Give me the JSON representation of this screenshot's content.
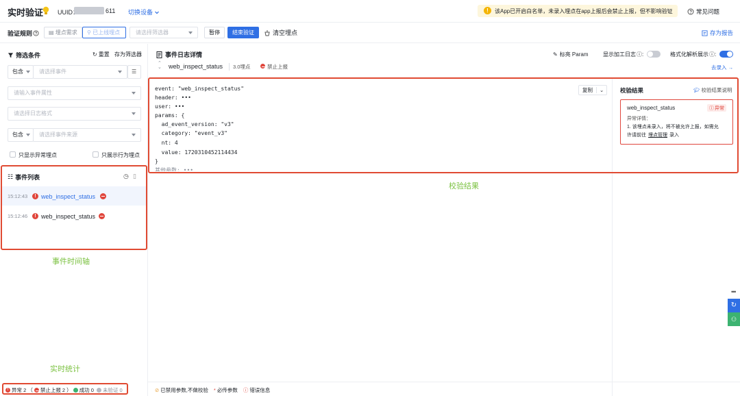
{
  "header": {
    "title": "实时验证",
    "uuid_label": "UUID：",
    "uuid_value": "611",
    "switch_device": "切换设备",
    "notice": "该App已开启白名单，未录入埋点在app上报后会禁止上报，但不影响验证",
    "faq": "常见问题"
  },
  "rulebar": {
    "label": "验证规则",
    "tracking_need": "埋点需求",
    "online_tracking": "已上线埋点",
    "filter_placeholder": "请选择筛选器",
    "pause": "暂停",
    "end_verify": "结束验证",
    "clear": "清空埋点",
    "save_report": "存为报告"
  },
  "filter": {
    "title": "筛选条件",
    "reset": "重置",
    "save_filter": "存为筛选器",
    "include_1": "包含",
    "event_placeholder": "请选择事件",
    "attr_placeholder": "请输入事件属性",
    "log_format_placeholder": "请选择日志格式",
    "include_2": "包含",
    "source_placeholder": "请选择事件来源",
    "only_abnormal": "只显示异常埋点",
    "only_behavior": "只展示行为埋点"
  },
  "event_list": {
    "title": "事件列表",
    "items": [
      {
        "time": "15:12:43",
        "name": "web_inspect_status"
      },
      {
        "time": "15:12:46",
        "name": "web_inspect_status"
      }
    ]
  },
  "detail": {
    "title": "事件日志详情",
    "highlight_param": "标亮 Param",
    "show_processed_log": "显示加工日志",
    "formatted_display": "格式化解析展示",
    "event_name": "web_inspect_status",
    "version": "3.0埋点",
    "forbid": "禁止上报",
    "go_record": "去录入 →",
    "copy": "复制"
  },
  "code_lines": [
    "event: \"web_inspect_status\"",
    "header: •••",
    "user: •••",
    "params: {",
    "  ad_event_version: \"v3\"",
    "  category: \"event_v3\"",
    "  nt: 4",
    "  value: 1720310452114434",
    "}",
    "其他参数: •••"
  ],
  "result": {
    "title": "校验结果",
    "explain": "校验结果说明",
    "event_name": "web_inspect_status",
    "badge": "异常",
    "detail_label": "异常详情：",
    "detail_text_1": "1. 该埋点未录入，将不被允许上报，如需允",
    "detail_text_2_prefix": "许请前往",
    "detail_link": "埋点管理",
    "detail_text_2_suffix": "录入"
  },
  "annotations": {
    "verify_result": "校验结果",
    "event_timeline": "事件时间轴",
    "realtime_stats": "实时统计"
  },
  "footer": {
    "abnormal": "异常 2 （",
    "forbid": "禁止上报 2 ）",
    "success": "成功 0",
    "unverified": "未验证 0",
    "disabled_params": "已禁用参数,不做校验",
    "required_params": "必传参数",
    "error_info": "错误信息"
  },
  "colors": {
    "accent": "#2f6fe4",
    "error": "#e0463c",
    "annotation": "#7cc242",
    "highlight_box": "#e04a32"
  }
}
